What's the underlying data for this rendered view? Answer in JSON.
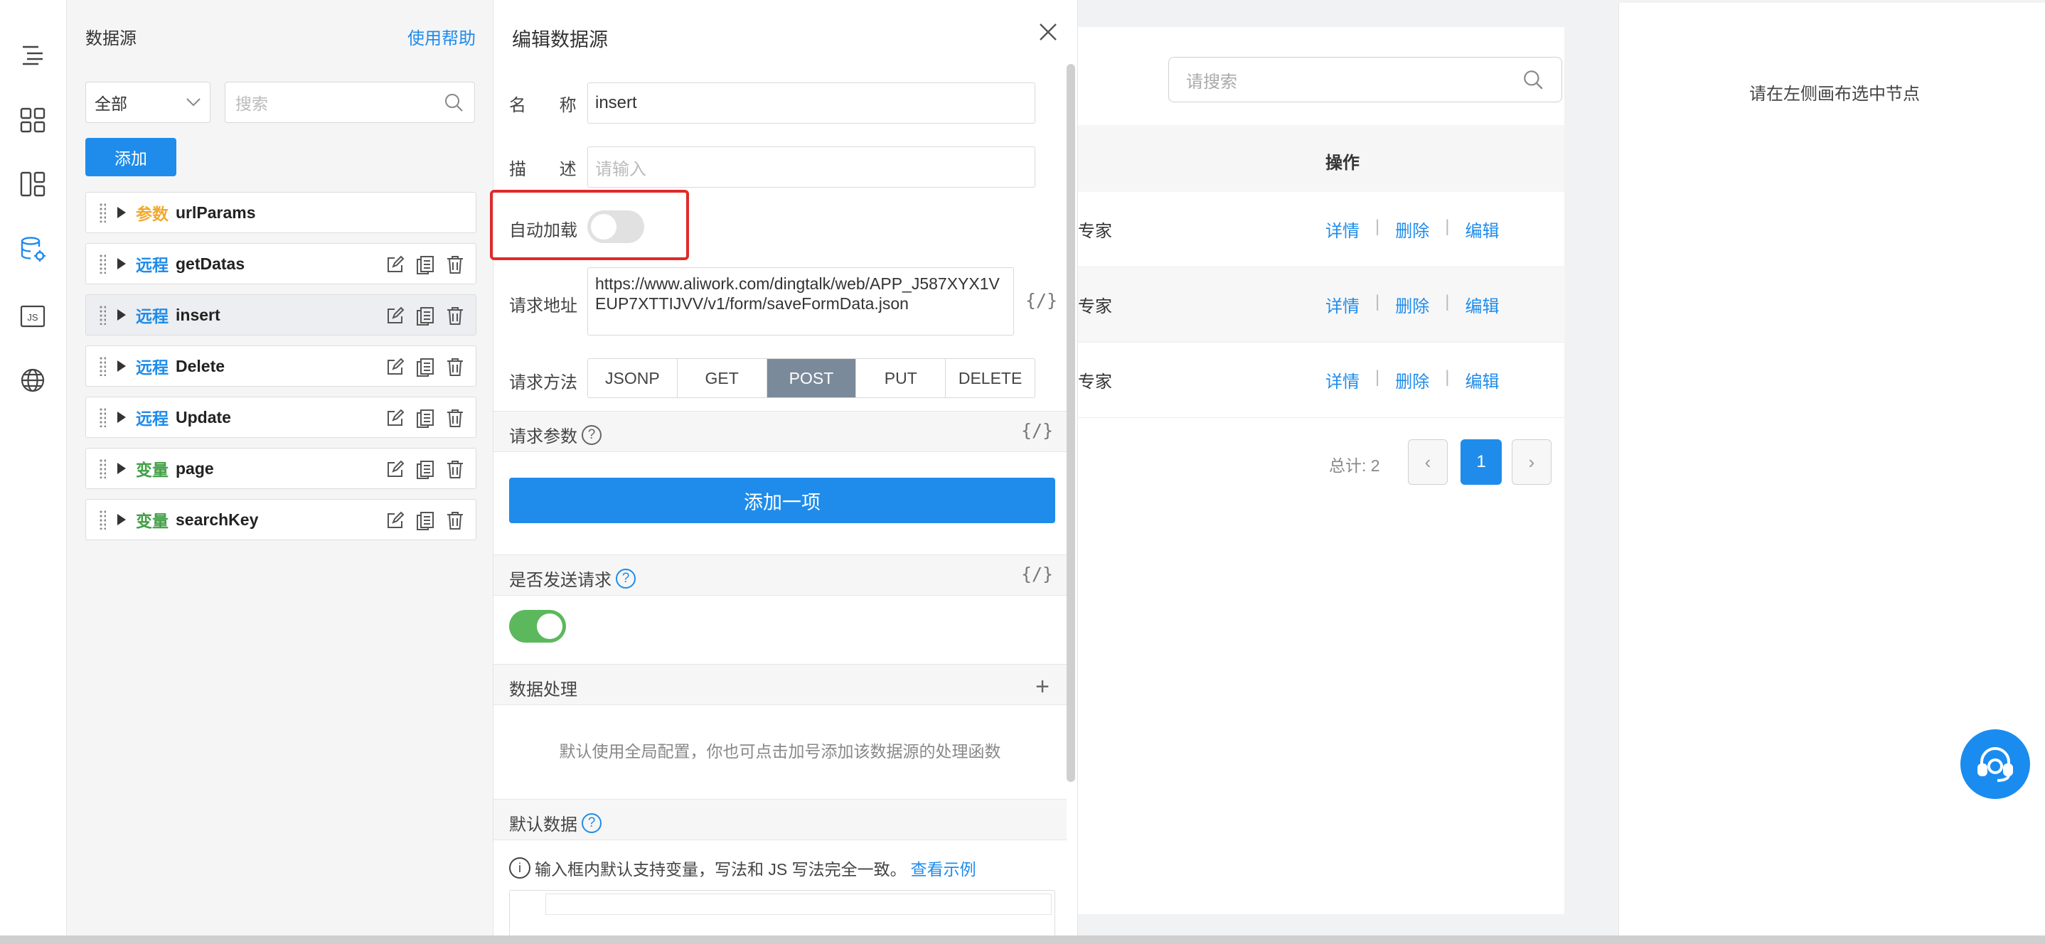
{
  "rail": {
    "icons": [
      "outline-icon",
      "components-icon",
      "layout-icon",
      "datasource-icon",
      "js-icon",
      "globe-icon"
    ],
    "active_color": "#1f8ceb"
  },
  "datasource_panel": {
    "title": "数据源",
    "help_link": "使用帮助",
    "filter_value": "全部",
    "search_placeholder": "搜索",
    "add_button": "添加",
    "items": [
      {
        "type_label": "参数",
        "name": "urlParams"
      },
      {
        "type_label": "远程",
        "name": "getDatas"
      },
      {
        "type_label": "远程",
        "name": "insert"
      },
      {
        "type_label": "远程",
        "name": "Delete"
      },
      {
        "type_label": "远程",
        "name": "Update"
      },
      {
        "type_label": "变量",
        "name": "page"
      },
      {
        "type_label": "变量",
        "name": "searchKey"
      }
    ]
  },
  "edit_panel": {
    "title": "编辑数据源",
    "name_label": "名 称",
    "name_value": "insert",
    "desc_label": "描 述",
    "desc_placeholder": "请输入",
    "autoload_label": "自动加载",
    "autoload_on": false,
    "url_label": "请求地址",
    "url_value": "https://www.aliwork.com/dingtalk/web/APP_J587XYX1VEUP7XTTIJVV/v1/form/saveFormData.json",
    "code_hint": "{/}",
    "method_label": "请求方法",
    "methods": [
      "JSONP",
      "GET",
      "POST",
      "PUT",
      "DELETE"
    ],
    "selected_method": "POST",
    "params_section": "请求参数",
    "add_item_button": "添加一项",
    "send_section": "是否发送请求",
    "send_on": true,
    "process_section": "数据处理",
    "process_note": "默认使用全局配置，你也可点击加号添加该数据源的处理函数",
    "default_section": "默认数据",
    "tip_text": "输入框内默认支持变量，写法和 JS 写法完全一致。",
    "tip_link": "查看示例",
    "highlight_color": "#e02a2a"
  },
  "canvas": {
    "search_placeholder": "请搜索",
    "header_op": "操作",
    "rows": [
      {
        "cell": "专家",
        "ops": [
          "详情",
          "删除",
          "编辑"
        ]
      },
      {
        "cell": "专家",
        "ops": [
          "详情",
          "删除",
          "编辑"
        ]
      },
      {
        "cell": "专家",
        "ops": [
          "详情",
          "删除",
          "编辑"
        ]
      }
    ],
    "separator": "|",
    "total": "总计: 2",
    "current_page": "1"
  },
  "right_panel": {
    "hint": "请在左侧画布选中节点"
  }
}
